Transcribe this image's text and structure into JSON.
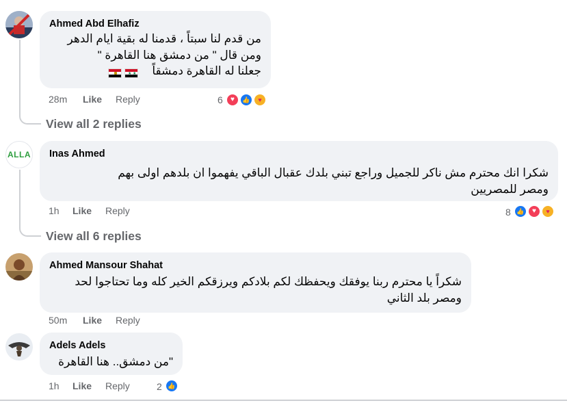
{
  "colors": {
    "bubble_bg": "#f0f2f5",
    "meta_text": "#65676b",
    "thread_line": "#ced0d4",
    "like_blue": "#1877f2",
    "love_red": "#f33e58",
    "care_yellow": "#f7b125"
  },
  "comments": [
    {
      "author": "Ahmed Abd Elhafiz",
      "lines": [
        "من قدم لنا سبتاً ، قدمنا له بقية ايام الدهر",
        "ومن قال \" من دمشق هنا القاهرة \"",
        "جعلنا له القاهرة دمشقاً"
      ],
      "flags": [
        "syria-flag",
        "egypt-flag"
      ],
      "time": "28m",
      "like_label": "Like",
      "reply_label": "Reply",
      "reaction_count": "6",
      "reactions": [
        "love",
        "like",
        "care"
      ],
      "view_replies": "View all 2 replies"
    },
    {
      "author": "Inas Ahmed",
      "avatar_text": "ALLA",
      "lines": [
        "شكرا انك محترم مش ناكر للجميل وراجع تبني بلدك عقبال الباقي يفهموا ان بلدهم اولى بهم",
        "ومصر للمصريين"
      ],
      "time": "1h",
      "like_label": "Like",
      "reply_label": "Reply",
      "reaction_count": "8",
      "reactions": [
        "like",
        "love",
        "care"
      ],
      "view_replies": "View all 6 replies"
    },
    {
      "author": "Ahmed Mansour Shahat",
      "lines": [
        "شكراً يا محترم ربنا يوفقك ويحفظك لكم بلادكم ويرزقكم الخير كله وما تحتاجوا لحد",
        "ومصر بلد الثاني"
      ],
      "time": "50m",
      "like_label": "Like",
      "reply_label": "Reply"
    },
    {
      "author": "Adels Adels",
      "lines": [
        "\"من دمشق.. هنا القاهرة"
      ],
      "time": "1h",
      "like_label": "Like",
      "reply_label": "Reply",
      "reaction_count": "2",
      "reactions": [
        "like"
      ]
    }
  ]
}
